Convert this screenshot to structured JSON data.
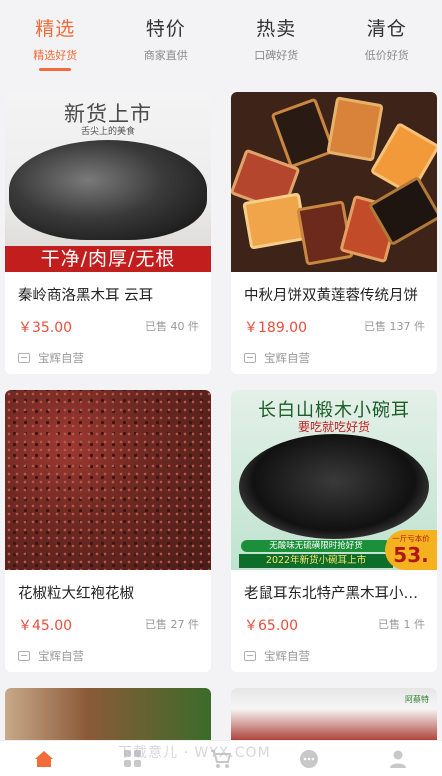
{
  "tabs": [
    {
      "title": "精选",
      "sub": "精选好货",
      "active": true
    },
    {
      "title": "特价",
      "sub": "商家直供",
      "active": false
    },
    {
      "title": "热卖",
      "sub": "口碑好货",
      "active": false
    },
    {
      "title": "清仓",
      "sub": "低价好货",
      "active": false
    }
  ],
  "products": [
    {
      "name": "秦岭商洛黑木耳 云耳",
      "price": "￥35.00",
      "sold": "已售 40 件",
      "shop": "宝辉自营",
      "image_text": {
        "headline": "新货上市",
        "sub": "舌尖上的美食",
        "banner": "干净/肉厚/无根"
      }
    },
    {
      "name": "中秋月饼双黄莲蓉传统月饼",
      "price": "￥189.00",
      "sold": "已售 137 件",
      "shop": "宝辉自营"
    },
    {
      "name": "花椒粒大红袍花椒",
      "price": "￥45.00",
      "sold": "已售 27 件",
      "shop": "宝辉自营"
    },
    {
      "name": "老鼠耳东北特产黑木耳小碗耳",
      "price": "￥65.00",
      "sold": "已售 1 件",
      "shop": "宝辉自营",
      "image_text": {
        "headline": "长白山椴木小碗耳",
        "sub": "要吃就吃好货",
        "strip": "无酸味无硫磺限时抢好货",
        "strip2": "2022年新货小碗耳上市",
        "badge_small": "一斤亏本价",
        "badge_big": "53."
      }
    }
  ],
  "partial_products": [
    {
      "logo": "阿蔡特"
    }
  ],
  "watermark": "下载意儿 · WYX.COM",
  "bottom_nav": [
    {
      "icon": "home-icon",
      "active": true
    },
    {
      "icon": "category-icon",
      "active": false
    },
    {
      "icon": "cart-icon",
      "active": false
    },
    {
      "icon": "message-icon",
      "active": false
    },
    {
      "icon": "profile-icon",
      "active": false
    }
  ],
  "colors": {
    "accent": "#f26b3a",
    "price": "#e94e3c"
  }
}
